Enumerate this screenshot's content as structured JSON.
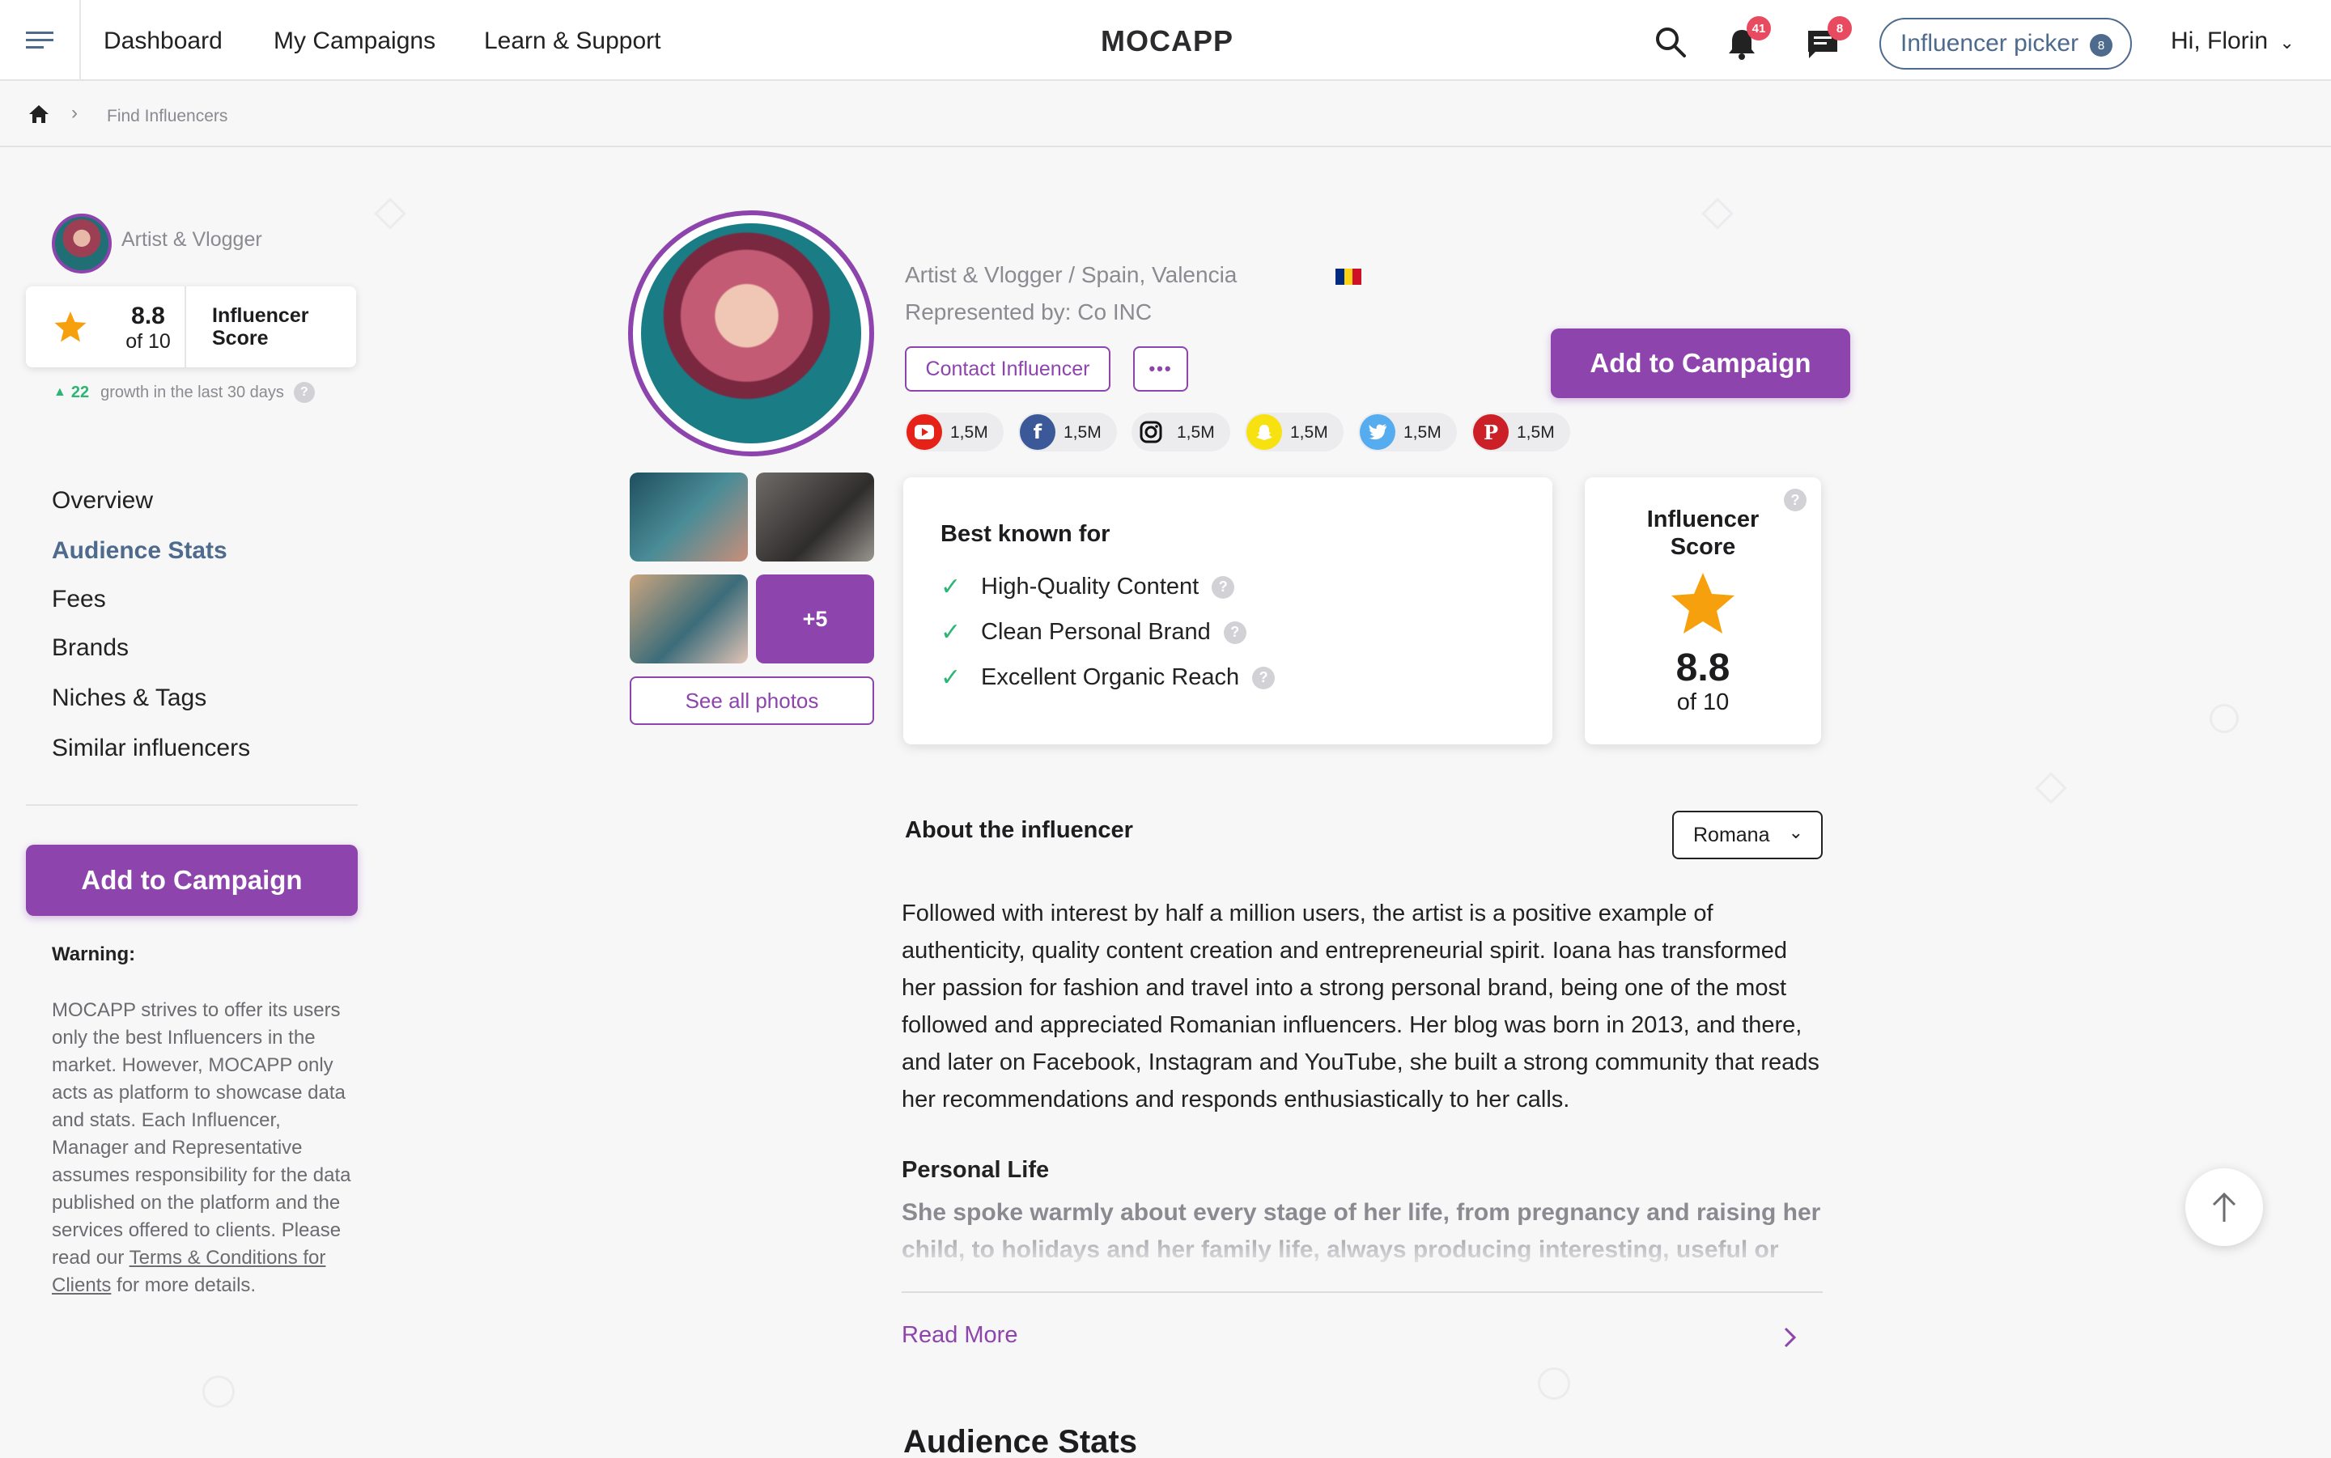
{
  "app": {
    "logo": "MOCAPP",
    "brand_color": "#8e44ad",
    "accent_blue": "#4e6a8c"
  },
  "topnav": {
    "menu_icon": "hamburger-icon",
    "links": [
      "Dashboard",
      "My Campaigns",
      "Learn & Support"
    ],
    "notifications_count": "41",
    "messages_count": "8",
    "picker_label": "Influencer picker",
    "picker_count": "8",
    "greeting": "Hi, Florin"
  },
  "breadcrumb": {
    "home_icon": "home-icon",
    "current": "Find Influencers"
  },
  "sidebar": {
    "title": "Artist & Vlogger",
    "score": "8.8",
    "score_of": "of 10",
    "score_label_1": "Influencer",
    "score_label_2": "Score",
    "growth_value": "22",
    "growth_text": "growth in the last 30 days",
    "nav": [
      "Overview",
      "Audience Stats",
      "Fees",
      "Brands",
      "Niches & Tags",
      "Similar influencers"
    ],
    "active_nav": "Audience Stats",
    "add_button": "Add to Campaign",
    "warning_title": "Warning:",
    "warning_body": "MOCAPP strives to offer its users only the best Influencers in the market. However, MOCAPP only acts as platform to showcase data and stats. Each Influencer, Manager and Representative assumes responsibility for the data published on the platform and the services offered to clients. Please read our ",
    "warning_link": "Terms & Conditions for Clients",
    "warning_tail": " for more details."
  },
  "profile": {
    "subtitle": "Artist & Vlogger / Spain, Valencia",
    "represented_by": "Represented by: Co INC",
    "contact_button": "Contact Influencer",
    "more_button": "•••",
    "add_button": "Add to Campaign",
    "more_photos": "+5",
    "see_all_photos": "See all photos",
    "socials": [
      {
        "icon": "youtube-icon",
        "value": "1,5M",
        "color": "#e62117"
      },
      {
        "icon": "facebook-icon",
        "value": "1,5M",
        "color": "#3b5998"
      },
      {
        "icon": "instagram-icon",
        "value": "1,5M",
        "color": "#111111"
      },
      {
        "icon": "snapchat-icon",
        "value": "1,5M",
        "color": "#f7e111"
      },
      {
        "icon": "twitter-icon",
        "value": "1,5M",
        "color": "#55acee"
      },
      {
        "icon": "pinterest-icon",
        "value": "1,5M",
        "color": "#cb2027"
      }
    ]
  },
  "best_known": {
    "title": "Best known for",
    "items": [
      "High-Quality Content",
      "Clean Personal Brand",
      "Excellent Organic Reach"
    ]
  },
  "score_card": {
    "title_1": "Influencer",
    "title_2": "Score",
    "score": "8.8",
    "of": "of 10"
  },
  "about": {
    "title": "About the influencer",
    "language": "Romana",
    "body": "Followed with interest by half a million users, the artist is a positive example of authenticity, quality content creation and entrepreneurial spirit. Ioana has transformed her passion for fashion and travel into a strong personal brand, being one of the most followed and appreciated Romanian influencers. Her blog was born in 2013, and there, and later on Facebook, Instagram and YouTube, she built a strong community that reads her recommendations and responds enthusiastically to her calls.",
    "personal_title": "Personal Life",
    "personal_body": "She spoke warmly about every stage of her life, from pregnancy and raising her child, to holidays and her family life, always producing interesting, useful or",
    "read_more": "Read More"
  },
  "audience_stats_title": "Audience Stats"
}
